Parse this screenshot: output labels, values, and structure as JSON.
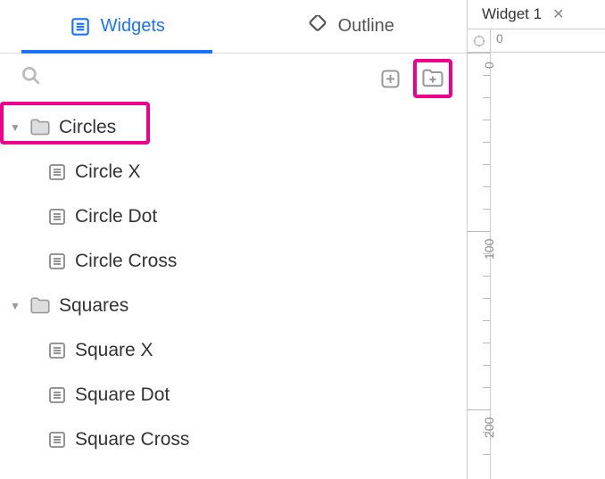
{
  "tabs": {
    "widgets": "Widgets",
    "outline": "Outline"
  },
  "tree": {
    "folders": [
      {
        "name": "Circles",
        "items": [
          "Circle X",
          "Circle Dot",
          "Circle Cross"
        ]
      },
      {
        "name": "Squares",
        "items": [
          "Square X",
          "Square Dot",
          "Square Cross"
        ]
      }
    ]
  },
  "canvas_tab": {
    "title": "Widget 1"
  },
  "ruler": {
    "origin": "0",
    "ticks": [
      "0",
      "100",
      "200"
    ]
  }
}
